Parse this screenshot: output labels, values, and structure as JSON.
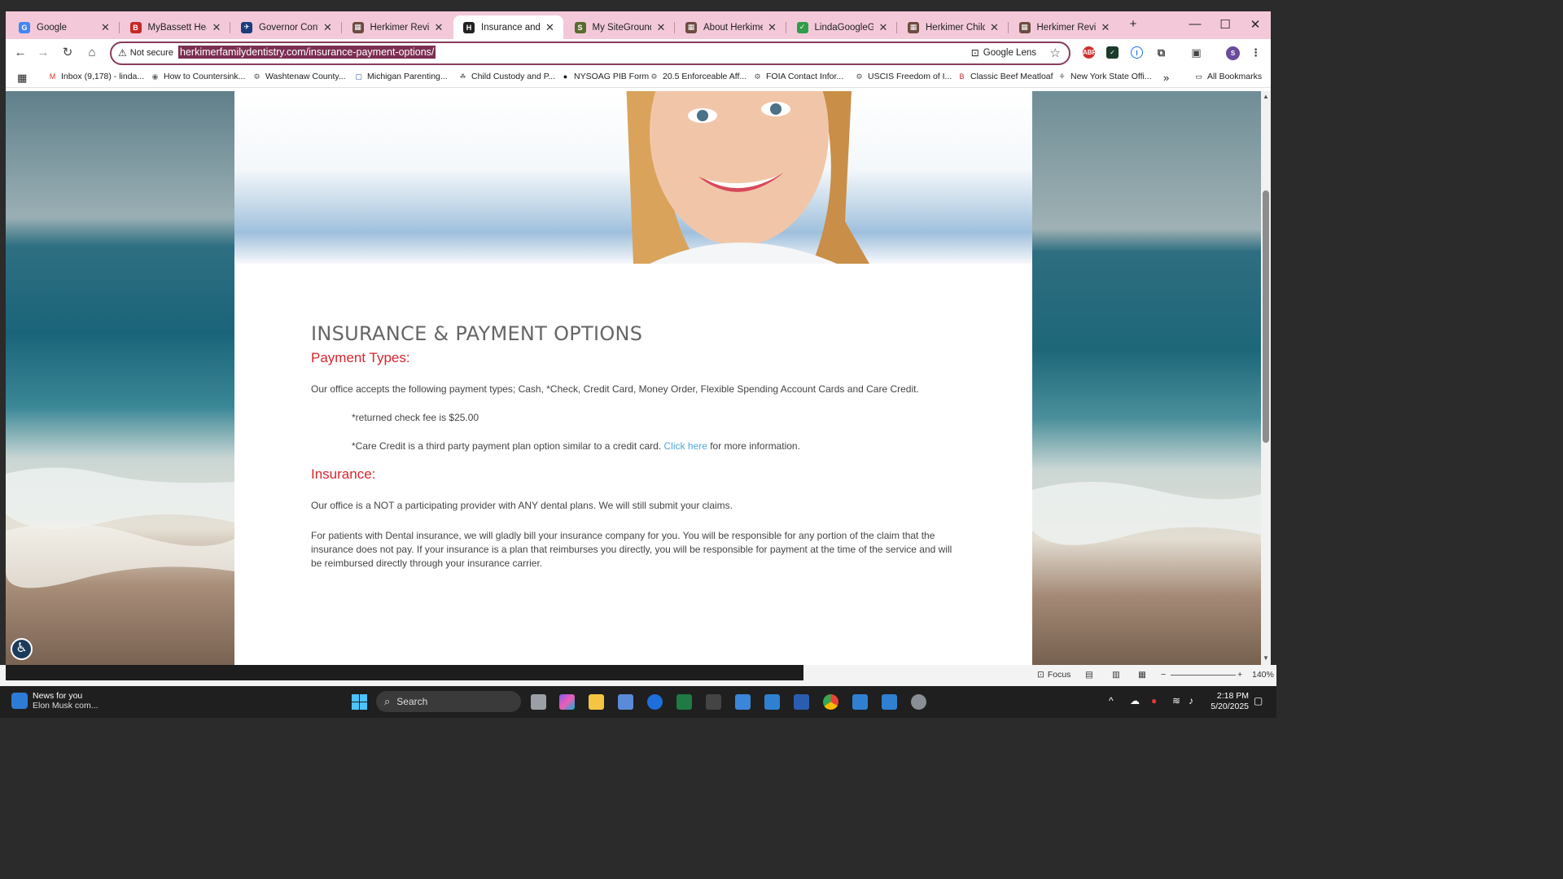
{
  "tabs": [
    {
      "title": "Google",
      "fav": "G",
      "color": "#4285f4"
    },
    {
      "title": "MyBassett Health",
      "fav": "B",
      "color": "#c62828"
    },
    {
      "title": "Governor Contact",
      "fav": "✈",
      "color": "#1a3d7c"
    },
    {
      "title": "Herkimer Revitaliz",
      "fav": "▦",
      "color": "#6d4c41"
    },
    {
      "title": "Insurance and Pay",
      "fav": "H",
      "color": "#222222"
    },
    {
      "title": "My SiteGround Ac",
      "fav": "S",
      "color": "#5a6b2e"
    },
    {
      "title": "About Herkimer Fa",
      "fav": "▦",
      "color": "#6d4c41"
    },
    {
      "title": "LindaGoogleGuide",
      "fav": "✓",
      "color": "#2e9e4a"
    },
    {
      "title": "Herkimer Child Pr",
      "fav": "▦",
      "color": "#6d4c41"
    },
    {
      "title": "Herkimer Revitaliz",
      "fav": "▦",
      "color": "#6d4c41"
    }
  ],
  "toolbar": {
    "not_secure": "Not secure",
    "url": "herkimerfamilydentistry.com/insurance-payment-options/",
    "lens": "Google Lens"
  },
  "bookmarks": [
    "Inbox (9,178) - linda...",
    "How to Countersink...",
    "Washtenaw County...",
    "Michigan Parenting...",
    "Child Custody and P...",
    "NYSOAG PIB Form",
    "20.5 Enforceable Aff...",
    "FOIA Contact Infor...",
    "USCIS Freedom of I...",
    "Classic Beef Meatloaf",
    "New York State Offi..."
  ],
  "all_bookmarks": "All Bookmarks",
  "content": {
    "title": "INSURANCE & PAYMENT OPTIONS",
    "payment_heading": "Payment Types:",
    "payment_text": "Our office accepts the following payment types; Cash, *Check, Credit Card, Money Order, Flexible Spending Account Cards and Care Credit.",
    "returned_check": "*returned check fee is $25.00",
    "care_credit_pre": "*Care Credit is a third party payment plan option similar to a credit card. ",
    "click_here": "Click here",
    "care_credit_post": " for more information.",
    "insurance_heading": "Insurance:",
    "insurance_text1": "Our office is a NOT a participating provider with ANY dental plans. We will still submit your claims.",
    "insurance_text2": "For patients with Dental insurance, we will gladly bill your insurance company for you.  You will be responsible for any portion of the claim that the insurance does not pay.  If your insurance is a plan that reimburses you directly, you will be responsible for payment at the time of the service and will be reimbursed directly through your insurance carrier."
  },
  "statusbar": {
    "focus": "Focus",
    "zoom": "140%"
  },
  "taskbar": {
    "news_title": "News for you",
    "news_sub": "Elon Musk com...",
    "search": "Search",
    "time": "2:18 PM",
    "date": "5/20/2025"
  }
}
